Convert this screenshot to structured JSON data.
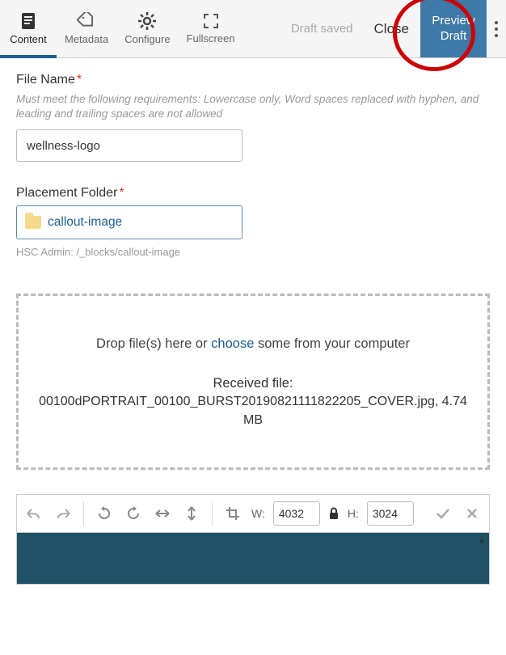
{
  "toolbar": {
    "tabs": [
      {
        "label": "Content"
      },
      {
        "label": "Metadata"
      },
      {
        "label": "Configure"
      },
      {
        "label": "Fullscreen"
      }
    ],
    "status": "Draft saved",
    "close": "Close",
    "preview": "Preview Draft"
  },
  "file_name": {
    "label": "File Name",
    "hint": "Must meet the following requirements: Lowercase only, Word spaces replaced with hyphen, and leading and trailing spaces are not allowed",
    "value": "wellness-logo"
  },
  "placement_folder": {
    "label": "Placement Folder",
    "value": "callout-image",
    "breadcrumb": "HSC Admin: /_blocks/callout-image"
  },
  "dropzone": {
    "pre_text": "Drop file(s) here or ",
    "choose": "choose",
    "post_text": " some from your computer",
    "received_label": "Received file:",
    "filename": "00100dPORTRAIT_00100_BURST20190821111822205_COVER.jpg, 4.74 MB"
  },
  "editor": {
    "w_label": "W:",
    "h_label": "H:",
    "width": "4032",
    "height": "3024"
  }
}
